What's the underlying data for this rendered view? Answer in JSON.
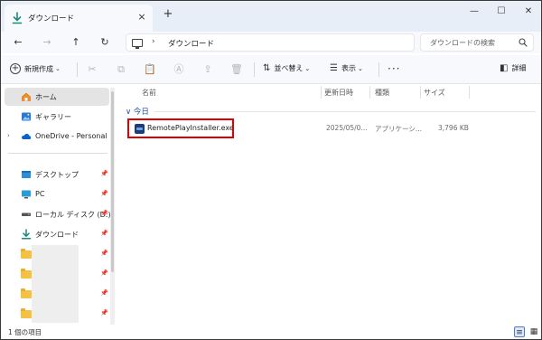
{
  "window": {
    "tab_title": "ダウンロード",
    "tab_close": "×",
    "new_tab": "+",
    "minimize": "—",
    "maximize": "☐",
    "close": "✕"
  },
  "address": {
    "back": "←",
    "forward": "→",
    "up": "↑",
    "refresh": "↻",
    "path_chevron": "›",
    "path_segment": "ダウンロード",
    "search_placeholder": "ダウンロードの検索"
  },
  "toolbar": {
    "new_label": "新規作成",
    "new_caret": "⌄",
    "cut": "✂",
    "copy": "⧉",
    "paste": "📋",
    "rename": "Ⓐ",
    "share": "⇪",
    "delete": "🗑",
    "sort_glyph": "⇅",
    "sort_label": "並べ替え",
    "view_glyph": "☰",
    "view_label": "表示",
    "more": "···",
    "details_glyph": "◧",
    "details_label": "詳細"
  },
  "sidebar": {
    "items": [
      {
        "label": "ホーム",
        "icon": "home-icon",
        "selected": true
      },
      {
        "label": "ギャラリー",
        "icon": "gallery-icon"
      },
      {
        "label": "OneDrive - Personal",
        "icon": "onedrive-icon",
        "expand": "›"
      },
      {
        "label": "デスクトップ",
        "icon": "desktop-icon",
        "pinned": true
      },
      {
        "label": "PC",
        "icon": "pc-icon",
        "pinned": true
      },
      {
        "label": "ローカル ディスク (D:)",
        "icon": "drive-icon",
        "pinned": true
      },
      {
        "label": "ダウンロード",
        "icon": "download-icon",
        "pinned": true
      }
    ],
    "pin_glyph": "📌"
  },
  "list": {
    "columns": [
      "名前",
      "更新日時",
      "種類",
      "サイズ"
    ],
    "group_label": "∨ 今日",
    "files": [
      {
        "name": "RemotePlayInstaller.exe",
        "modified": "2025/05/0...",
        "type": "アプリケーシ...",
        "size": "3,796 KB"
      }
    ]
  },
  "status": {
    "item_count": "1 個の項目"
  },
  "colors": {
    "accent": "#1b4f9a",
    "highlight": "#e00000",
    "folder": "#f4c142",
    "titlebar": "#e8eef7"
  }
}
